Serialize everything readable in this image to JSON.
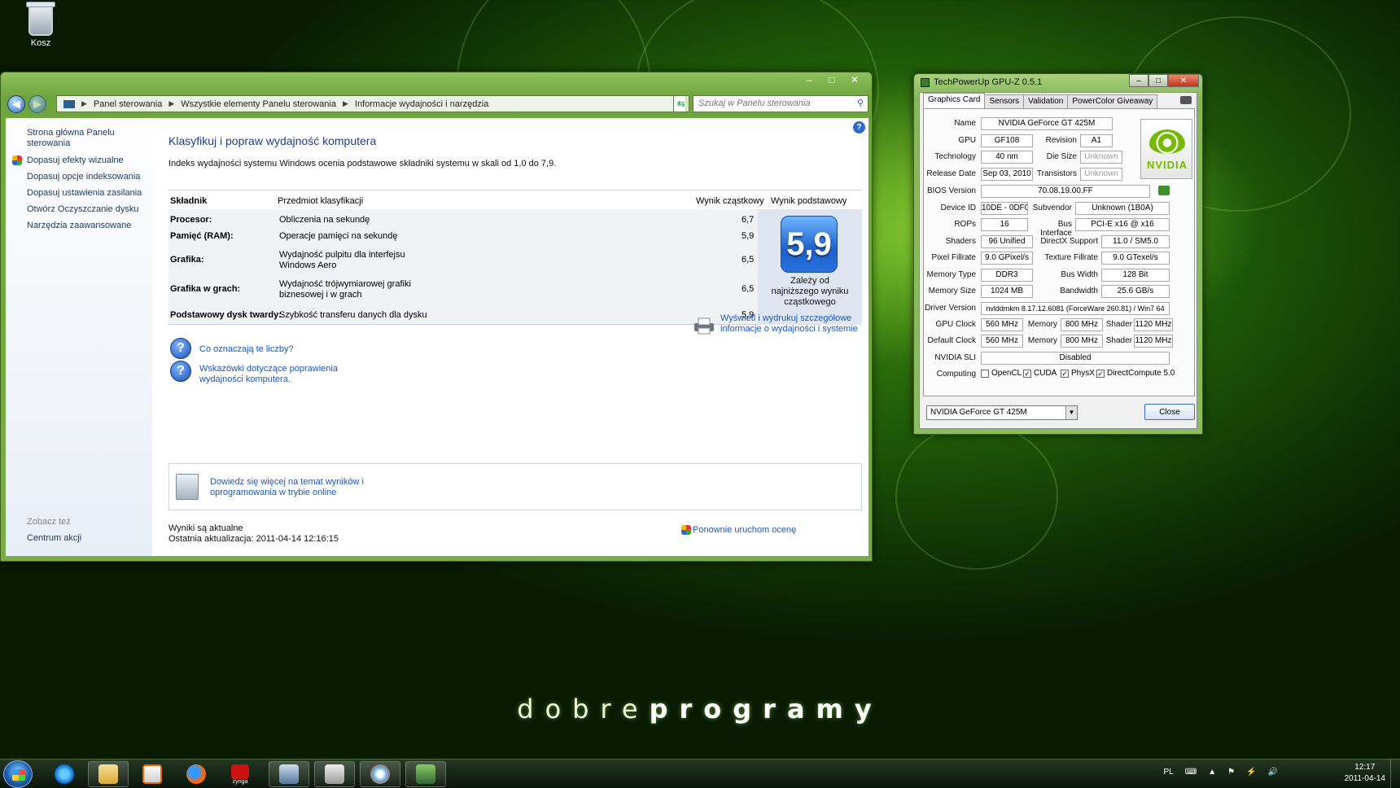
{
  "desktop": {
    "recycle_bin_label": "Kosz",
    "brand_light": "dobre",
    "brand_bold": "programy"
  },
  "cp": {
    "window_buttons": [
      "–",
      "□",
      "✕"
    ],
    "breadcrumb": [
      "Panel sterowania",
      "Wszystkie elementy Panelu sterowania",
      "Informacje wydajności i narzędzia"
    ],
    "search_placeholder": "Szukaj w Panelu sterowania",
    "sidebar": {
      "home": "Strona główna Panelu sterowania",
      "links": [
        "Dopasuj efekty wizualne",
        "Dopasuj opcje indeksowania",
        "Dopasuj ustawienia zasilania",
        "Otwórz Oczyszczanie dysku",
        "Narzędzia zaawansowane"
      ],
      "see_also": "Zobacz też",
      "action_center": "Centrum akcji"
    },
    "title": "Klasyfikuj i popraw wydajność komputera",
    "description": "Indeks wydajności systemu Windows ocenia podstawowe składniki systemu w skali od 1,0 do 7,9.",
    "headers": {
      "component": "Składnik",
      "subject": "Przedmiot klasyfikacji",
      "subscore": "Wynik cząstkowy",
      "base": "Wynik podstawowy"
    },
    "rows": [
      {
        "component": "Procesor:",
        "subject": "Obliczenia na sekundę",
        "score": "6,7"
      },
      {
        "component": "Pamięć (RAM):",
        "subject": "Operacje pamięci na sekundę",
        "score": "5,9"
      },
      {
        "component": "Grafika:",
        "subject": "Wydajność pulpitu dla interfejsu Windows Aero",
        "score": "6,5"
      },
      {
        "component": "Grafika w grach:",
        "subject": "Wydajność trójwymiarowej grafiki biznesowej i w grach",
        "score": "6,5"
      },
      {
        "component": "Podstawowy dysk twardy:",
        "subject": "Szybkość transferu danych dla dysku",
        "score": "5,9"
      }
    ],
    "base_score": "5,9",
    "base_note": "Zależy od najniższego wyniku cząstkowego",
    "links": {
      "what_numbers": "Co oznaczają te liczby?",
      "tips": "Wskazówki dotyczące poprawienia wydajności komputera.",
      "print": "Wyświetl i wydrukuj szczegółowe informacje o wydajności i systemie",
      "online": "Dowiedz się więcej na temat wyników i oprogramowania w trybie online",
      "rerun": "Ponownie uruchom ocenę"
    },
    "status_current": "Wyniki są aktualne",
    "last_update": "Ostatnia aktualizacja: 2011-04-14 12:16:15"
  },
  "gpuz": {
    "title": "TechPowerUp GPU-Z 0.5.1",
    "tabs": [
      "Graphics Card",
      "Sensors",
      "Validation",
      "PowerColor Giveaway"
    ],
    "labels": {
      "name": "Name",
      "gpu": "GPU",
      "revision": "Revision",
      "technology": "Technology",
      "die_size": "Die Size",
      "release_date": "Release Date",
      "transistors": "Transistors",
      "bios": "BIOS Version",
      "device_id": "Device ID",
      "subvendor": "Subvendor",
      "rops": "ROPs",
      "bus_interface": "Bus Interface",
      "shaders": "Shaders",
      "directx": "DirectX Support",
      "pixel_fillrate": "Pixel Fillrate",
      "texture_fillrate": "Texture Fillrate",
      "memory_type": "Memory Type",
      "bus_width": "Bus Width",
      "memory_size": "Memory Size",
      "bandwidth": "Bandwidth",
      "driver": "Driver Version",
      "gpu_clock": "GPU Clock",
      "memory": "Memory",
      "shader": "Shader",
      "default_clock": "Default Clock",
      "sli": "NVIDIA SLI",
      "computing": "Computing"
    },
    "values": {
      "name": "NVIDIA GeForce GT 425M",
      "gpu": "GF108",
      "revision": "A1",
      "technology": "40 nm",
      "die_size": "Unknown",
      "release_date": "Sep 03, 2010",
      "transistors": "Unknown",
      "bios": "70.08.19.00.FF",
      "device_id": "10DE - 0DF0",
      "subvendor": "Unknown (1B0A)",
      "rops": "16",
      "bus_interface": "PCI-E x16 @ x16",
      "shaders": "96 Unified",
      "directx": "11.0 / SM5.0",
      "pixel_fillrate": "9.0 GPixel/s",
      "texture_fillrate": "9.0 GTexel/s",
      "memory_type": "DDR3",
      "bus_width": "128 Bit",
      "memory_size": "1024 MB",
      "bandwidth": "25.6 GB/s",
      "driver": "nvlddmkm 8.17.12.6081 (ForceWare 260.81) / Win7 64",
      "gpu_clock": "560 MHz",
      "gpu_memory": "800 MHz",
      "gpu_shader": "1120 MHz",
      "default_clock": "560 MHz",
      "default_memory": "800 MHz",
      "default_shader": "1120 MHz",
      "sli": "Disabled"
    },
    "logo_text": "NVIDIA",
    "computing": [
      {
        "label": "OpenCL",
        "checked": ""
      },
      {
        "label": "CUDA",
        "checked": "✓"
      },
      {
        "label": "PhysX",
        "checked": "✓"
      },
      {
        "label": "DirectCompute 5.0",
        "checked": "✓"
      }
    ],
    "selected_card": "NVIDIA GeForce GT 425M",
    "close": "Close"
  },
  "taskbar": {
    "lang": "PL",
    "time": "12:17",
    "date": "2011-04-14",
    "icons": [
      "internet-explorer-icon",
      "explorer-icon",
      "media-player-icon",
      "firefox-icon",
      "zynga-icon",
      "performance-icon",
      "calculator-icon",
      "paint-icon",
      "gpuz-icon"
    ],
    "zynga_label": "zynga"
  }
}
